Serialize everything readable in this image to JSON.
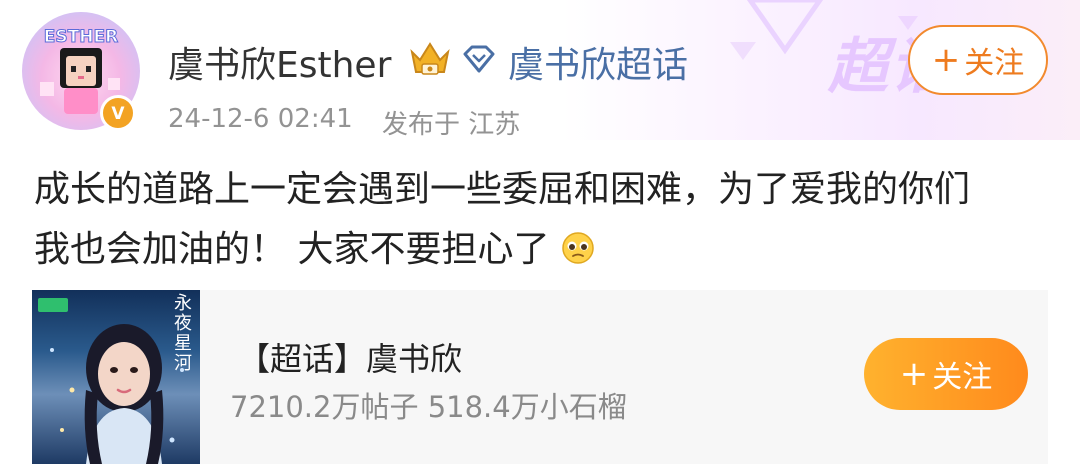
{
  "post": {
    "author": {
      "name": "虞书欣Esther",
      "avatar_text": "ESTHER",
      "verified_badge": "V"
    },
    "topic_link": "虞书欣超话",
    "timestamp": "24-12-6 02:41",
    "location": "发布于 江苏",
    "follow_label": "关注",
    "content_lines": [
      "成长的道路上一定会遇到一些委屈和困难，为了爱我的你们",
      "我也会加油的！ 大家不要担心了"
    ],
    "emoji": "pleading-face-emoji"
  },
  "banner": {
    "watermark_text": "超话"
  },
  "topic_card": {
    "title": "【超话】虞书欣",
    "posts_count": "7210.2万帖子",
    "fans_count": "518.4万小石榴",
    "follow_label": "关注",
    "cover_caption": "永夜星河"
  },
  "colors": {
    "accent_orange": "#f28a2e",
    "link_blue": "#4a6fa5",
    "meta_gray": "#939393",
    "card_bg": "#f7f7f7"
  }
}
